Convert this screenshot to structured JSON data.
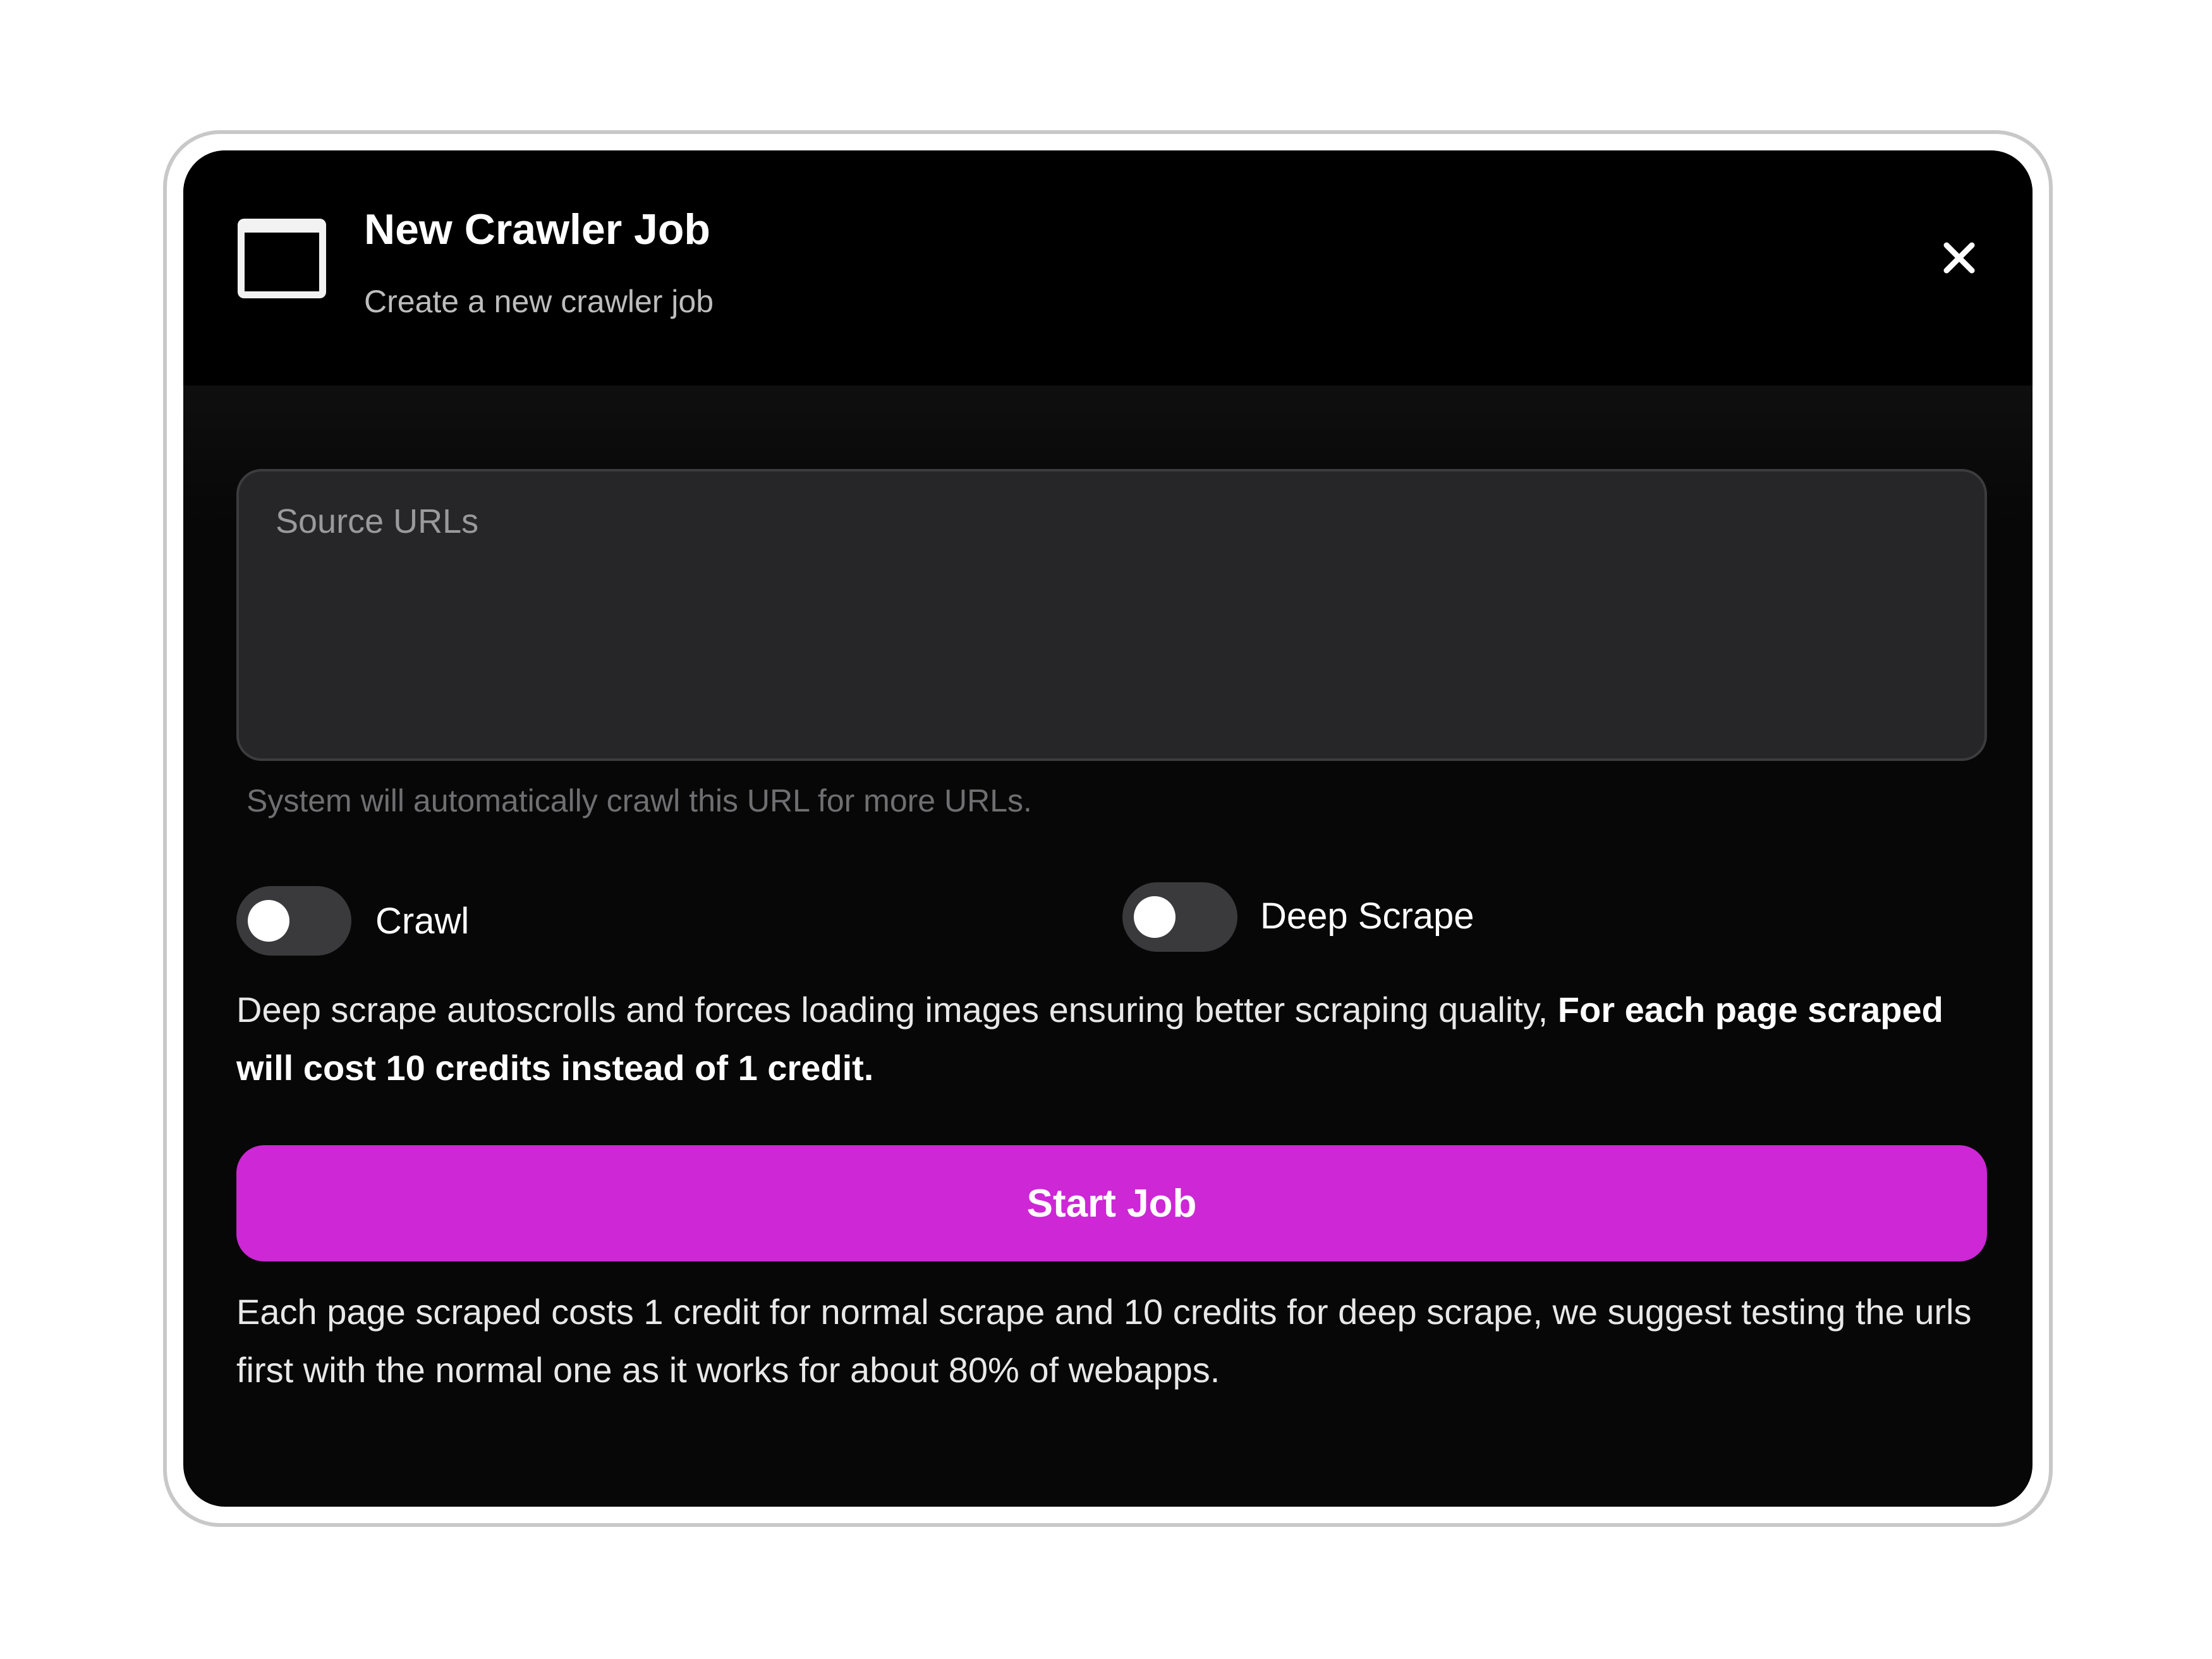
{
  "header": {
    "title": "New Crawler Job",
    "subtitle": "Create a new crawler job",
    "icon": "window-icon",
    "close_icon": "close-icon"
  },
  "form": {
    "source_urls": {
      "placeholder": "Source URLs",
      "value": ""
    },
    "helper_text": "System will automatically crawl this URL for more URLs.",
    "toggles": [
      {
        "label": "Crawl",
        "on": false
      },
      {
        "label": "Deep Scrape",
        "on": false
      }
    ],
    "deep_note": {
      "text": "Deep scrape autoscrolls and forces loading images ensuring better scraping quality, ",
      "bold": "For each page scraped will cost 10 credits instead of 1 credit."
    },
    "submit_label": "Start Job",
    "cost_note": "Each page scraped costs 1 credit for normal scrape and 10 credits for deep scrape, we suggest testing the urls first with the normal one as it works for about 80% of webapps."
  },
  "colors": {
    "accent": "#cd27d6",
    "background": "#070707",
    "input_background": "#262628"
  }
}
